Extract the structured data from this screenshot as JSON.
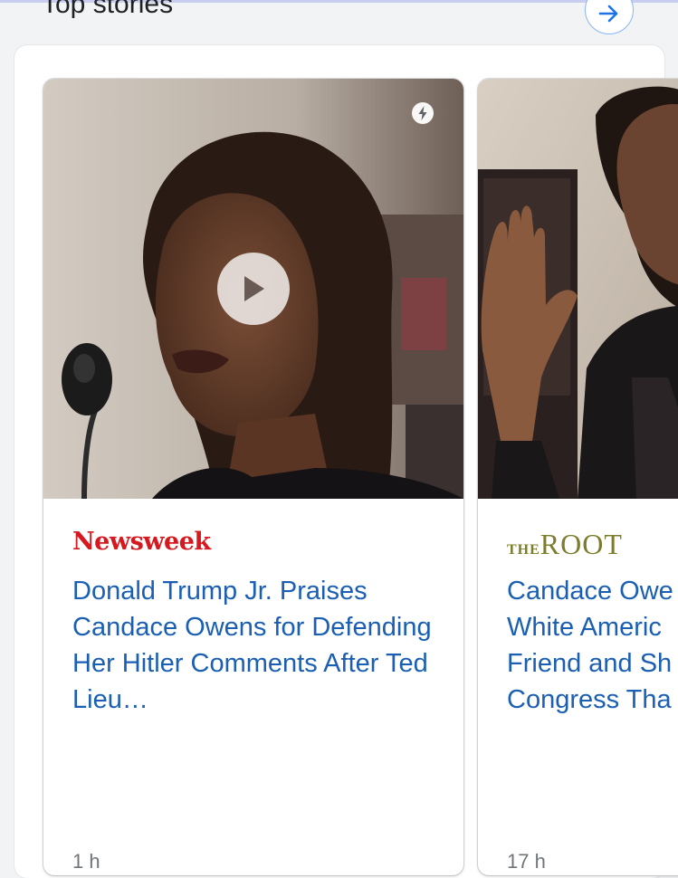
{
  "section": {
    "title": "Top stories",
    "more_icon": "arrow-right-icon"
  },
  "colors": {
    "headline": "#1a5fb4",
    "newsweek_red": "#d7191f",
    "root_olive": "#7b7d2c",
    "background": "#f1f3f4"
  },
  "stories": [
    {
      "source": "Newsweek",
      "headline": "Donald Trump Jr. Praises Candace Owens for Defending Her Hitler Comments After Ted Lieu…",
      "badge_icon": "amp-lightning-icon",
      "media_icon": "play-icon",
      "timestamp": "1 h"
    },
    {
      "source_small": "THE",
      "source_big": "ROOT",
      "headline_lines": [
        "Candace Owe",
        "White Americ",
        "Friend and Sh",
        "Congress Tha"
      ],
      "timestamp": "17 h"
    }
  ]
}
